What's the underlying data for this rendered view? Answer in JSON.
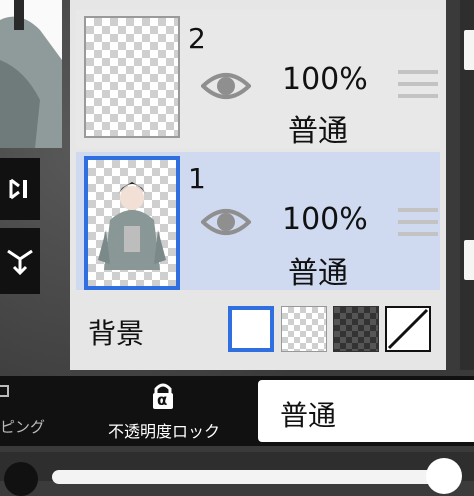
{
  "layers": [
    {
      "number": "2",
      "opacity": "100%",
      "blend_mode": "普通",
      "selected": false
    },
    {
      "number": "1",
      "opacity": "100%",
      "blend_mode": "普通",
      "selected": true
    }
  ],
  "background": {
    "label": "背景",
    "options": [
      "white",
      "light-checker",
      "dark-checker",
      "none"
    ],
    "selected": "white"
  },
  "toolbar": {
    "clipping_label": "ピング",
    "lock_label": "不透明度ロック",
    "lock_icon_glyph": "α",
    "blend_mode_value": "普通"
  },
  "colors": {
    "accent": "#2f6fe0",
    "selected_row": "#cfdaf0",
    "panel": "#e6e6e6"
  }
}
